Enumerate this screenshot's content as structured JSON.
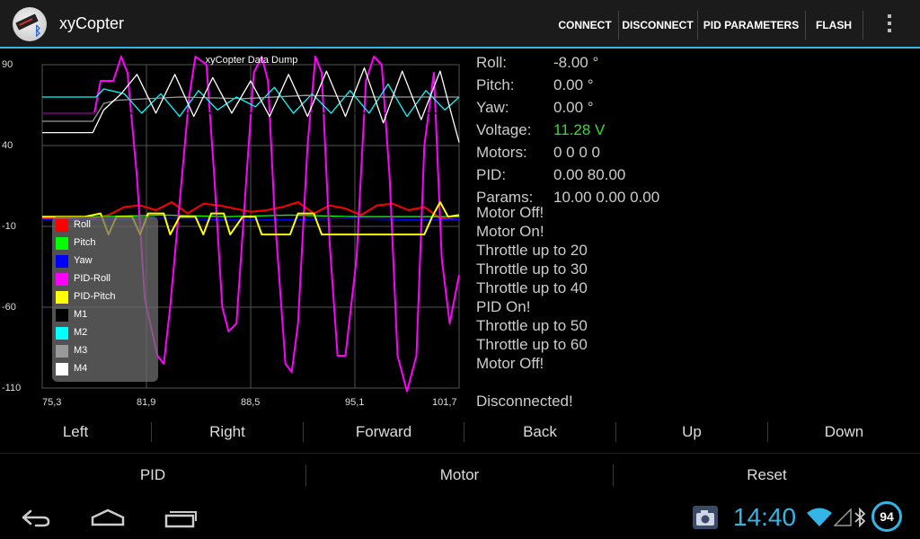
{
  "app": {
    "title": "xyCopter"
  },
  "actionbar": {
    "connect": "CONNECT",
    "disconnect": "DISCONNECT",
    "pid_parameters": "PID PARAMETERS",
    "flash": "FLASH"
  },
  "chart_data": {
    "type": "line",
    "title": "xyCopter Data Dump",
    "xlim": [
      75.3,
      101.7
    ],
    "ylim": [
      -110,
      90
    ],
    "x_ticks": [
      "75,3",
      "81,9",
      "88,5",
      "95,1",
      "101,7"
    ],
    "y_ticks": [
      "90",
      "40",
      "-10",
      "-60",
      "-110"
    ],
    "grid": true,
    "legend_placement": "bottom-left",
    "series": [
      {
        "name": "Roll",
        "color": "#ff0000",
        "x": [
          75.3,
          77.0,
          78.0,
          79.5,
          80.5,
          81.5,
          82.5,
          83.5,
          84.5,
          85.5,
          86.5,
          87.5,
          88.5,
          89.5,
          90.5,
          91.5,
          92.5,
          93.5,
          94.5,
          95.5,
          96.5,
          97.5,
          98.5,
          99.5,
          100.5,
          101.7
        ],
        "y": [
          -5,
          -5,
          -6,
          -3,
          2,
          3,
          0,
          5,
          -2,
          4,
          3,
          1,
          -1,
          0,
          2,
          5,
          -2,
          3,
          1,
          -3,
          3,
          4,
          0,
          2,
          -5,
          -6
        ]
      },
      {
        "name": "Pitch",
        "color": "#00ff00",
        "x": [
          75.3,
          79.0,
          83.0,
          87.0,
          91.0,
          95.0,
          99.0,
          101.7
        ],
        "y": [
          -4,
          -4,
          -3,
          -4,
          -3,
          -4,
          -4,
          -4
        ]
      },
      {
        "name": "Yaw",
        "color": "#0000ff",
        "x": [
          75.3,
          79.0,
          83.0,
          87.0,
          91.0,
          95.0,
          99.0,
          101.7
        ],
        "y": [
          -6,
          -6,
          -5,
          -6,
          -6,
          -5,
          -6,
          -6
        ]
      },
      {
        "name": "PID-Roll",
        "color": "#ff00ff",
        "x": [
          75.3,
          78.6,
          79.0,
          79.8,
          80.3,
          80.7,
          81.3,
          81.8,
          82.6,
          83.0,
          83.4,
          84.6,
          85.0,
          85.7,
          86.2,
          86.7,
          87.1,
          87.6,
          88.3,
          88.7,
          89.2,
          89.6,
          90.0,
          90.7,
          91.1,
          91.5,
          92.1,
          92.6,
          93.0,
          93.5,
          94.0,
          94.5,
          95.2,
          95.8,
          96.3,
          96.8,
          97.3,
          97.8,
          98.4,
          99.0,
          99.5,
          100.1,
          100.6,
          101.1,
          101.7
        ],
        "y": [
          60,
          60,
          80,
          80,
          95,
          85,
          20,
          -55,
          -90,
          -95,
          -60,
          70,
          95,
          90,
          20,
          -60,
          -75,
          -70,
          30,
          85,
          95,
          80,
          0,
          -95,
          -100,
          -70,
          40,
          95,
          85,
          -20,
          -90,
          -90,
          -30,
          80,
          95,
          90,
          20,
          -90,
          -112,
          -90,
          40,
          85,
          -30,
          -70,
          -40
        ]
      },
      {
        "name": "PID-Pitch",
        "color": "#ffff00",
        "x": [
          75.3,
          78.0,
          79.0,
          79.5,
          80.0,
          81.0,
          81.5,
          82.0,
          83.0,
          83.4,
          84.0,
          85.0,
          85.5,
          86.0,
          86.8,
          87.2,
          88.0,
          88.8,
          89.2,
          90.0,
          91.0,
          91.5,
          92.5,
          93.0,
          94.5,
          95.0,
          96.0,
          96.5,
          97.5,
          98.0,
          99.0,
          99.5,
          100.0,
          100.5,
          101.0,
          101.7
        ],
        "y": [
          -4,
          -4,
          -2,
          -15,
          -4,
          -4,
          -15,
          -2,
          -2,
          -15,
          -4,
          -4,
          -15,
          -2,
          -2,
          -15,
          -4,
          -4,
          -15,
          -15,
          -15,
          -2,
          -2,
          -15,
          -15,
          -15,
          -15,
          -15,
          -15,
          -15,
          -15,
          -15,
          -4,
          5,
          -4,
          -3
        ]
      },
      {
        "name": "M1",
        "color": "#000000",
        "x": [
          75.3,
          101.7
        ],
        "y": [
          60,
          60
        ]
      },
      {
        "name": "M2",
        "color": "#00ffff",
        "x": [
          75.3,
          78.7,
          79.2,
          80.5,
          81.6,
          82.8,
          84.0,
          85.2,
          86.4,
          87.6,
          88.8,
          90.0,
          91.2,
          92.4,
          93.6,
          94.8,
          96.0,
          97.2,
          98.4,
          99.6,
          100.8,
          101.7
        ],
        "y": [
          70,
          70,
          75,
          72,
          60,
          72,
          58,
          74,
          62,
          70,
          64,
          76,
          60,
          72,
          60,
          74,
          60,
          78,
          58,
          74,
          62,
          70
        ]
      },
      {
        "name": "M3",
        "color": "#999999",
        "x": [
          75.3,
          78.5,
          79.2,
          80.0,
          84.0,
          88.0,
          92.0,
          96.0,
          100.0,
          101.7
        ],
        "y": [
          55,
          55,
          66,
          68,
          70,
          69,
          71,
          70,
          70,
          70
        ]
      },
      {
        "name": "M4",
        "color": "#ffffff",
        "x": [
          75.3,
          78.5,
          79.2,
          80.3,
          81.3,
          82.5,
          83.7,
          84.9,
          86.1,
          87.3,
          88.5,
          89.7,
          90.9,
          92.1,
          93.3,
          94.5,
          95.7,
          96.9,
          98.1,
          99.3,
          100.5,
          101.2,
          101.7
        ],
        "y": [
          48,
          48,
          62,
          72,
          84,
          60,
          84,
          58,
          82,
          60,
          80,
          58,
          84,
          58,
          86,
          58,
          88,
          54,
          86,
          56,
          86,
          60,
          42
        ]
      }
    ]
  },
  "info": {
    "roll_label": "Roll:",
    "roll_value": "-8.00 °",
    "pitch_label": "Pitch:",
    "pitch_value": "0.00 °",
    "yaw_label": "Yaw:",
    "yaw_value": "0.00 °",
    "voltage_label": "Voltage:",
    "voltage_value": "11.28 V",
    "voltage_color": "#33dd33",
    "motors_label": "Motors:",
    "motors_value": "0 0 0 0",
    "pid_label": "PID:",
    "pid_value": "0.00 80.00",
    "params_label": "Params:",
    "params_value": "10.00 0.00 0.00"
  },
  "log": [
    "Motor Off!",
    "Motor On!",
    "Throttle up to 20",
    "Throttle up to 30",
    "Throttle up to 40",
    "PID On!",
    "Throttle up to 50",
    "Throttle up to 60",
    "Motor Off!",
    "",
    "Disconnected!"
  ],
  "controls": {
    "left": "Left",
    "right": "Right",
    "forward": "Forward",
    "back": "Back",
    "up": "Up",
    "down": "Down",
    "pid": "PID",
    "motor": "Motor",
    "reset": "Reset"
  },
  "status": {
    "clock": "14:40",
    "battery": "94",
    "accent": "#33b5e5"
  },
  "icons": [
    "back-icon",
    "home-icon",
    "recent-apps-icon",
    "camera-icon",
    "wifi-icon",
    "signal-icon",
    "bluetooth-icon",
    "overflow-menu-icon"
  ]
}
